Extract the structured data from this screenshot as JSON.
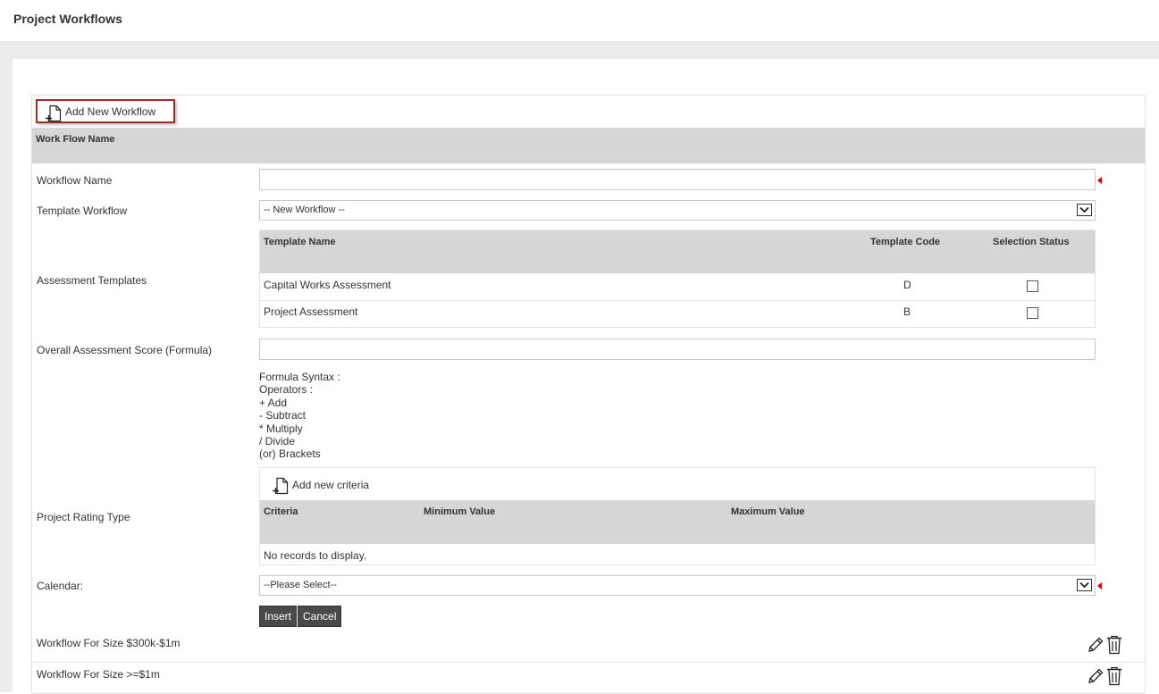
{
  "page": {
    "title": "Project Workflows"
  },
  "toolbar": {
    "add_label": "Add New Workflow"
  },
  "grid": {
    "header": "Work Flow Name"
  },
  "form": {
    "workflow_name_label": "Workflow Name",
    "workflow_name_value": "",
    "template_workflow_label": "Template Workflow",
    "template_workflow_value": "-- New Workflow --",
    "assessment_templates_label": "Assessment Templates",
    "templates_table": {
      "columns": [
        "Template Name",
        "Template Code",
        "Selection Status"
      ],
      "rows": [
        {
          "name": "Capital Works Assessment",
          "code": "D",
          "selected": false
        },
        {
          "name": "Project Assessment",
          "code": "B",
          "selected": false
        }
      ]
    },
    "overall_score_label": "Overall Assessment Score (Formula)",
    "overall_score_value": "",
    "formula_syntax": [
      "Formula Syntax :",
      "Operators :",
      "+ Add",
      "- Subtract",
      "* Multiply",
      "/ Divide",
      "(or) Brackets"
    ],
    "rating_type_label": "Project Rating Type",
    "criteria": {
      "add_label": "Add new criteria",
      "columns": [
        "Criteria",
        "Minimum Value",
        "Maximum Value"
      ],
      "empty_text": "No records to display."
    },
    "calendar_label": "Calendar:",
    "calendar_value": "--Please Select--",
    "insert_label": "Insert",
    "cancel_label": "Cancel"
  },
  "workflows": [
    {
      "name": "Workflow For Size $300k-$1m"
    },
    {
      "name": "Workflow For Size >=$1m"
    }
  ],
  "icons": {
    "add": "new-document-icon",
    "edit": "pencil-icon",
    "delete": "trash-icon",
    "dropdown": "chevron-down-icon"
  },
  "colors": {
    "header_gray": "#d6d6d6",
    "button_dark": "#4a4a4a",
    "highlight_border": "#a52a2a",
    "required": "#dd0000"
  }
}
